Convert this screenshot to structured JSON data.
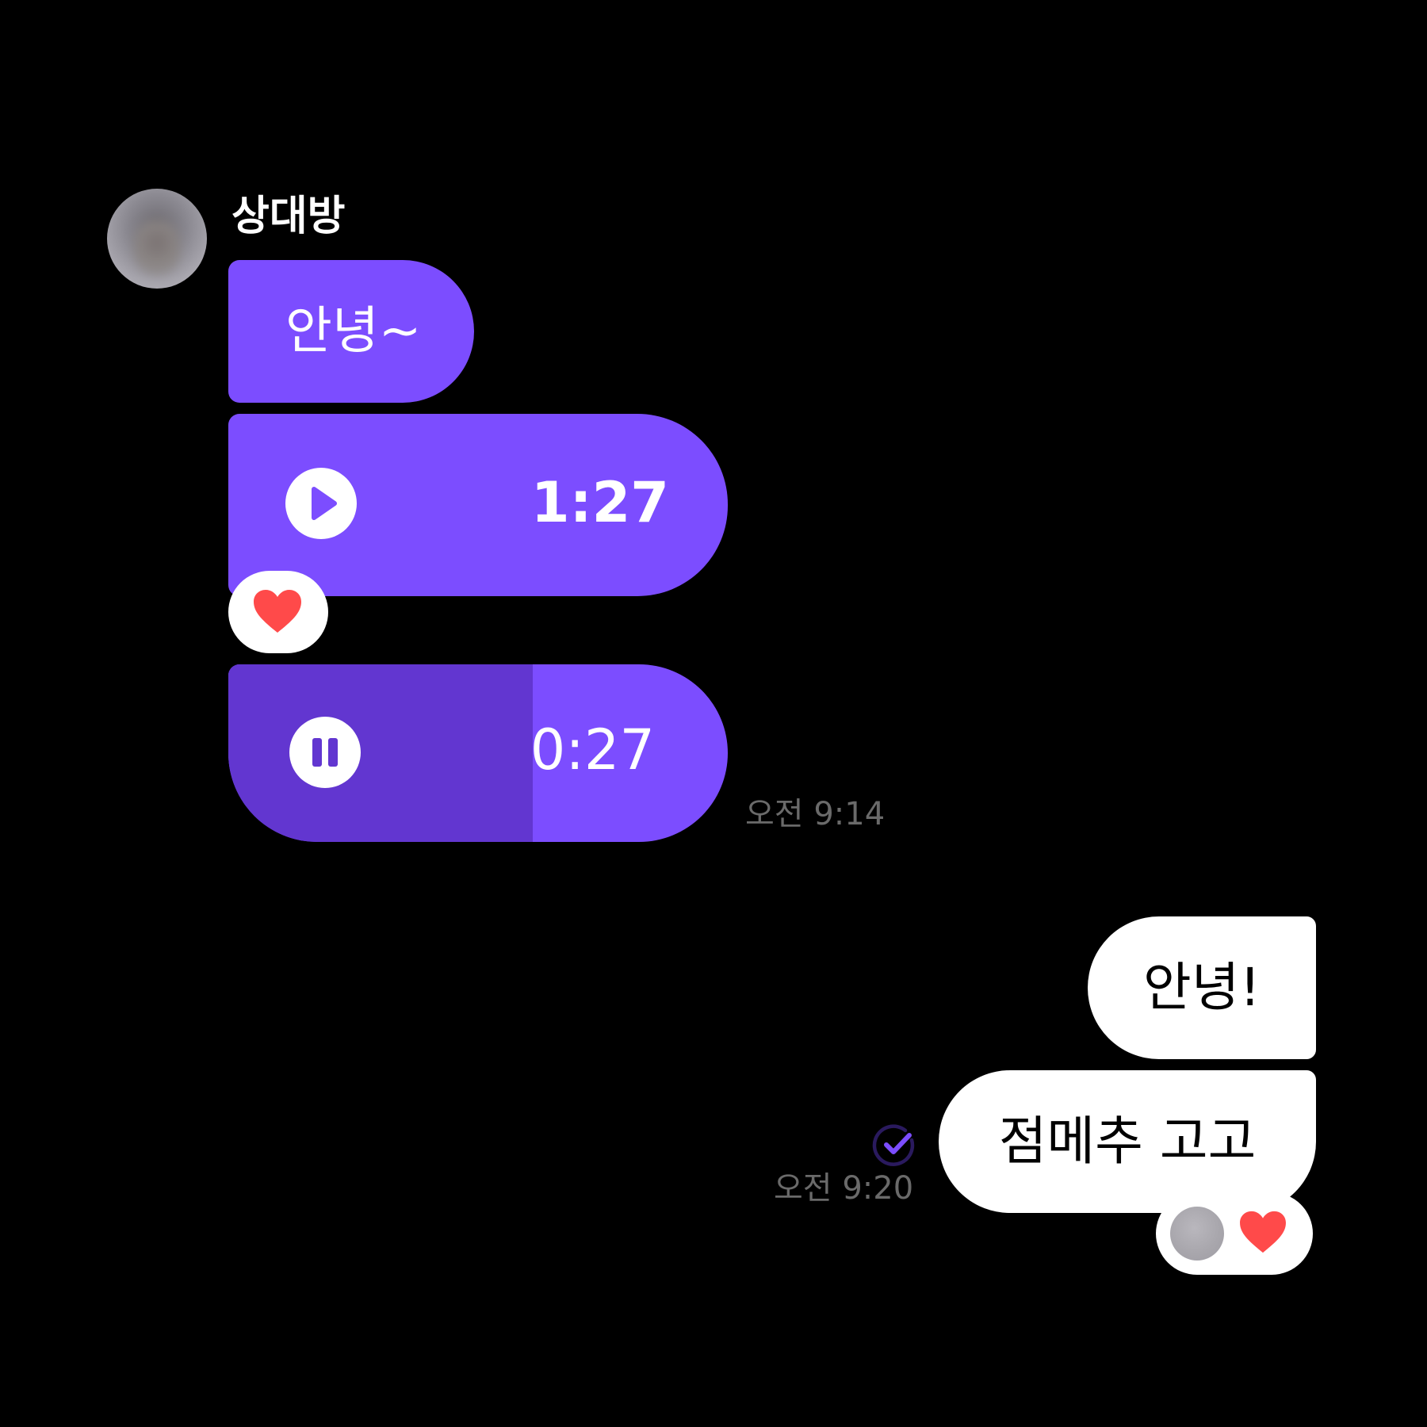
{
  "chat": {
    "sender_name": "상대방",
    "incoming": {
      "text_message": "안녕~",
      "voice_messages": [
        {
          "duration": "1:27",
          "state": "play",
          "progress": 0.0,
          "reaction": "heart"
        },
        {
          "duration": "0:27",
          "state": "pause",
          "progress": 0.61
        }
      ],
      "timestamp": "오전 9:14"
    },
    "outgoing": {
      "messages": [
        "안녕!",
        "점메추 고고"
      ],
      "timestamp": "오전 9:20",
      "read_status": "read-check-icon",
      "reaction": "heart"
    }
  },
  "colors": {
    "background": "#000000",
    "incoming_bubble": "#7c4dff",
    "voice_progress": "#6236d0",
    "outgoing_bubble": "#ffffff",
    "heart": "#ff4a4a",
    "timestamp": "#6a6a6a",
    "read_check": "#7c4dff"
  }
}
